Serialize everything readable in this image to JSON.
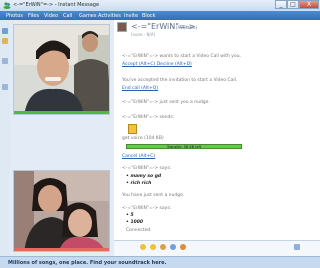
{
  "window": {
    "title": "<-=\"ErWiN\"=-> - Instant Message",
    "buttons": [
      "_",
      "□",
      "X"
    ]
  },
  "menu": [
    "Photos",
    "Files",
    "Video",
    "Call",
    "Games",
    "Activities",
    "Invite",
    "Block"
  ],
  "contact": {
    "name": "<-=\"ErWiN\"=->",
    "status": "(Available)",
    "sub": "(none - N/A)"
  },
  "chat": [
    {
      "text": "<-=\"ErWiN\"=-> wants to start a Video Call with you.",
      "style": "gray"
    },
    {
      "text": "Accept (Alt+C)  Decline (Alt+D)",
      "style": "link"
    },
    {
      "text": "You've accepted the invitation to start a Video Call.",
      "style": "gray"
    },
    {
      "text": "End call (Alt+Q)",
      "style": "link"
    },
    {
      "text": "<-=\"ErWiN\"=-> just sent you a nudge.",
      "style": "gray"
    },
    {
      "text": "<-=\"ErWiN\"=-> sends:",
      "style": "gray"
    },
    {
      "text": "get.voice (104 KB)",
      "style": "gray"
    },
    {
      "text": "Cancel (Alt+C)",
      "style": "link"
    },
    {
      "text": "<-=\"ErWiN\"=-> says:",
      "style": "gray"
    },
    {
      "text": "• mamy so gd",
      "style": "bold"
    },
    {
      "text": "• rich rich",
      "style": "bold"
    },
    {
      "text": "You have just sent a nudge.",
      "style": "gray"
    },
    {
      "text": "<-=\"ErWiN\"=-> says:",
      "style": "gray"
    },
    {
      "text": "• 5",
      "style": "bold"
    },
    {
      "text": "• 1000",
      "style": "bold"
    },
    {
      "text": "Connected.",
      "style": "gray"
    }
  ],
  "transfer": {
    "label": "Transfer: 58 KB left",
    "progress": 0.45
  },
  "ad": {
    "text": "Millions of songs, one place. Find your soundtrack here."
  }
}
